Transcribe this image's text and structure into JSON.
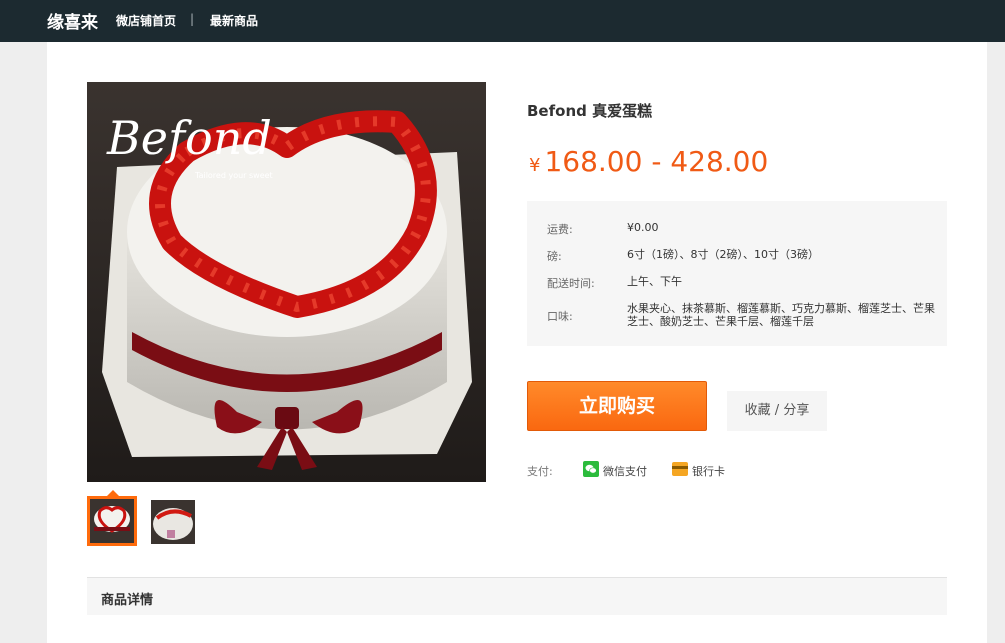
{
  "header": {
    "brand": "缘喜来",
    "nav": {
      "home": "微店铺首页",
      "separator": "|",
      "new_items": "最新商品"
    }
  },
  "product": {
    "title": "Befond 真爱蛋糕",
    "price": {
      "currency": "¥",
      "range": "168.00 - 428.00"
    },
    "image": {
      "logo_text": "Befond",
      "tagline": "Tailored your sweet"
    },
    "specs": [
      {
        "label": "运费:",
        "value": "¥0.00"
      },
      {
        "label": "磅:",
        "value": "6寸（1磅）、8寸（2磅）、10寸（3磅）"
      },
      {
        "label": "配送时间:",
        "value": "上午、下午"
      },
      {
        "label": "口味:",
        "value": "水果夹心、抹茶慕斯、榴莲慕斯、巧克力慕斯、榴莲芝士、芒果芝士、酸奶芝士、芒果千层、榴莲千层"
      }
    ],
    "actions": {
      "buy": "立即购买",
      "favorite": "收藏 / 分享"
    },
    "payment": {
      "label": "支付:",
      "wechat": "微信支付",
      "bank": "银行卡"
    }
  },
  "details": {
    "title": "商品详情"
  },
  "colors": {
    "accent": "#f05a15",
    "topbar": "#1c2a30",
    "wechat": "#2bbb3c",
    "card": "#f5a623"
  }
}
